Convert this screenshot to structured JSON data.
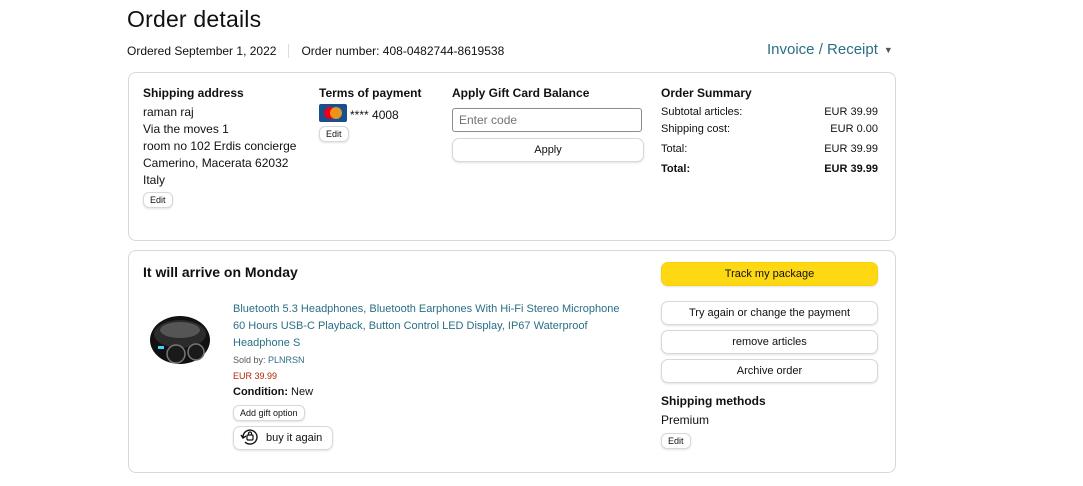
{
  "header": {
    "title": "Order details",
    "ordered": "Ordered September 1, 2022",
    "order_number": "Order number: 408-0482744-8619538",
    "invoice": "Invoice / Receipt"
  },
  "shipping_address": {
    "heading": "Shipping address",
    "lines": [
      "raman raj",
      "Via the moves 1",
      "room no 102 Erdis concierge",
      "Camerino, Macerata 62032",
      "Italy"
    ],
    "edit": "Edit"
  },
  "payment": {
    "heading": "Terms of payment",
    "card_mask": "**** 4008",
    "edit": "Edit"
  },
  "gift_card": {
    "heading": "Apply Gift Card Balance",
    "placeholder": "Enter code",
    "apply": "Apply"
  },
  "summary": {
    "heading": "Order Summary",
    "rows": [
      {
        "label": "Subtotal articles:",
        "value": "EUR 39.99"
      },
      {
        "label": "Shipping cost:",
        "value": "EUR 0.00"
      },
      {
        "label": "Total:",
        "value": "EUR 39.99"
      }
    ],
    "grand_label": "Total:",
    "grand_value": "EUR 39.99"
  },
  "shipment": {
    "arrival": "It will arrive on Monday",
    "product_title": "Bluetooth 5.3 Headphones, Bluetooth Earphones With Hi-Fi Stereo Microphone 60 Hours USB-C Playback, Button Control LED Display, IP67 Waterproof Headphone S",
    "sold_by_label": "Sold by:",
    "seller": "PLNRSN",
    "price": "EUR 39.99",
    "condition_label": "Condition:",
    "condition_value": "New",
    "add_gift": "Add gift option",
    "buy_again": "buy it again"
  },
  "actions": {
    "track": "Track my package",
    "retry_payment": "Try again or change the payment",
    "remove": "remove articles",
    "archive": "Archive order"
  },
  "shipping_methods": {
    "heading": "Shipping methods",
    "value": "Premium",
    "edit": "Edit"
  },
  "colors": {
    "link": "#2a6f86",
    "price": "#b12704",
    "primary_button": "#ffd814"
  },
  "icons": {
    "card": "mastercard-icon",
    "buy_again": "rebuy-icon",
    "dropdown": "chevron-down-icon"
  }
}
